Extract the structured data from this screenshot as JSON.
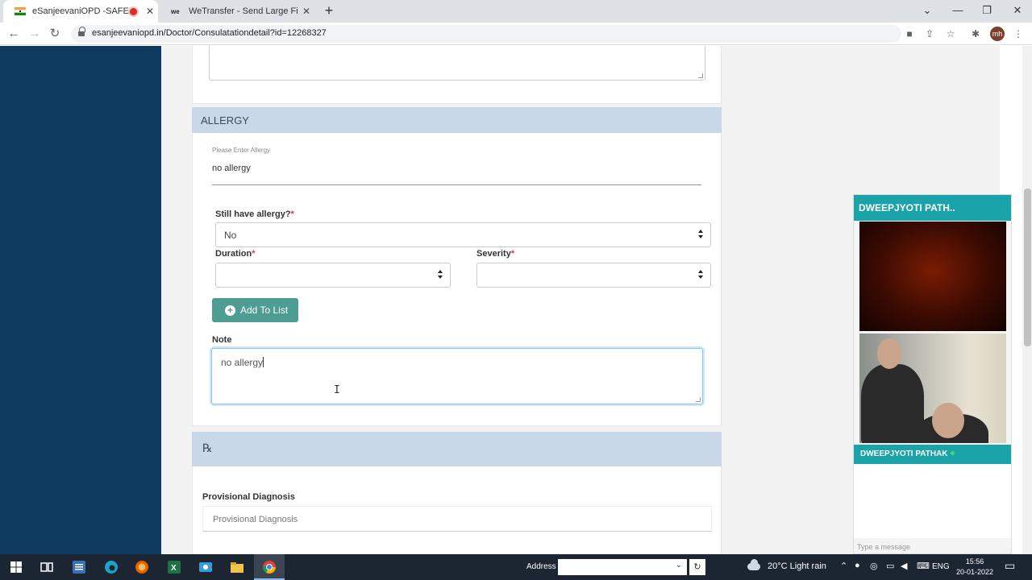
{
  "browser": {
    "tabs": [
      {
        "title": "eSanjeevaniOPD -SAFE HOM",
        "active": true,
        "recording": true
      },
      {
        "title": "WeTransfer - Send Large Files &",
        "active": false
      }
    ],
    "url": "esanjeevaniopd.in/Doctor/Consulatationdetail?id=12268327",
    "profile_initials": "mh"
  },
  "allergy": {
    "heading": "ALLERGY",
    "input_label": "Please Enter Allergy",
    "input_value": "no allergy",
    "still_have_label": "Still have allergy?",
    "still_have_value": "No",
    "duration_label": "Duration",
    "severity_label": "Severity",
    "required_mark": "*",
    "add_button": "Add To List",
    "note_label": "Note",
    "note_value": "no allergy"
  },
  "rx": {
    "symbol": "℞",
    "provisional_label": "Provisional Diagnosis",
    "provisional_placeholder": "Provisional Diagnosis"
  },
  "video_call": {
    "header_name": "DWEEPJYOTI PATH..",
    "participant_name": "DWEEPJYOTI PATHAK",
    "message_placeholder": "Type a message"
  },
  "taskbar": {
    "address_label": "Address",
    "weather": "20°C  Light rain",
    "language": "ENG",
    "time": "15:56",
    "date": "20-01-2022"
  },
  "colors": {
    "sidebar": "#0d3a5e",
    "section_header": "#c9d8e8",
    "add_button": "#4e9d93",
    "video_accent": "#1aa3a8"
  }
}
